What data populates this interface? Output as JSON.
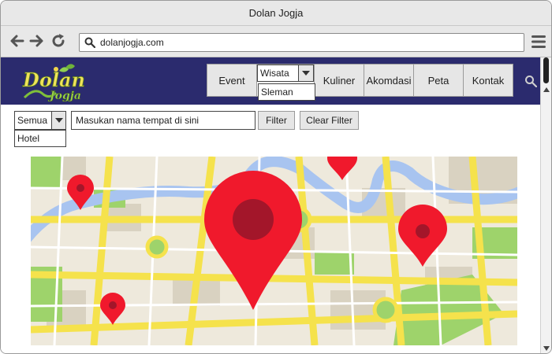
{
  "window": {
    "title": "Dolan Jogja"
  },
  "browser": {
    "url": "dolanjogja.com",
    "back_icon": "arrow-left-icon",
    "forward_icon": "arrow-right-icon",
    "reload_icon": "reload-icon",
    "menu_icon": "hamburger-menu-icon"
  },
  "site": {
    "logo": {
      "text_main": "Dolan",
      "text_sub": "Jogja"
    },
    "menu": {
      "event": "Event",
      "wisata": {
        "selected": "Wisata",
        "option": "Sleman"
      },
      "kuliner": "Kuliner",
      "akomodasi": "Akomdasi",
      "peta": "Peta",
      "kontak": "Kontak"
    },
    "colors": {
      "header_bg": "#2b2b6e",
      "pin_red": "#f0192c"
    }
  },
  "filters": {
    "category": {
      "selected": "Semua",
      "option": "Hotel"
    },
    "search": {
      "value": "Masukan nama tempat di sini"
    },
    "filter_button": "Filter",
    "clear_button": "Clear Filter"
  }
}
